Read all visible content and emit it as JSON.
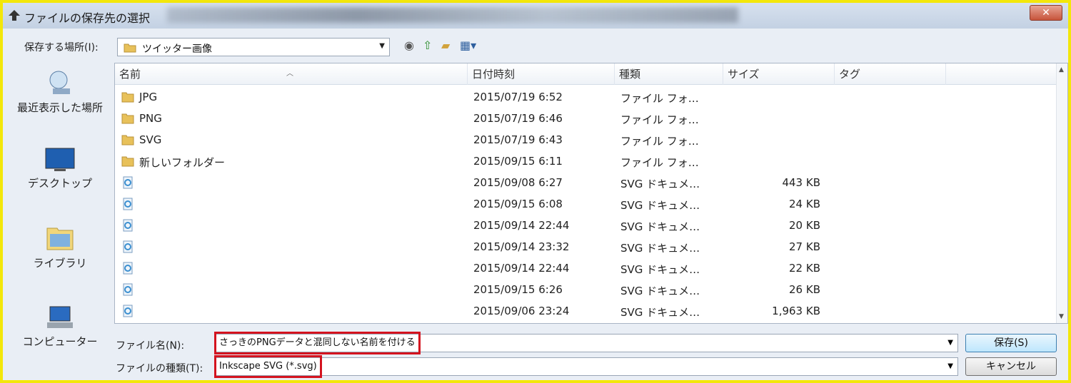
{
  "window": {
    "title": "ファイルの保存先の選択",
    "close_label": "✕"
  },
  "location": {
    "label": "保存する場所(I):",
    "value": "ツイッター画像"
  },
  "toolbar": {
    "back_icon": "back-icon",
    "up_icon": "up-folder-icon",
    "new_folder_icon": "new-folder-icon",
    "view_icon": "view-menu-icon"
  },
  "sidebar": {
    "items": [
      {
        "label": "最近表示した場所",
        "icon": "recent-places-icon"
      },
      {
        "label": "デスクトップ",
        "icon": "desktop-icon"
      },
      {
        "label": "ライブラリ",
        "icon": "library-icon"
      },
      {
        "label": "コンピューター",
        "icon": "computer-icon"
      }
    ]
  },
  "columns": [
    "名前",
    "日付時刻",
    "種類",
    "サイズ",
    "タグ"
  ],
  "files": [
    {
      "name": "JPG",
      "date": "2015/07/19 6:52",
      "type": "ファイル フォ…",
      "size": "",
      "kind": "folder"
    },
    {
      "name": "PNG",
      "date": "2015/07/19 6:46",
      "type": "ファイル フォ…",
      "size": "",
      "kind": "folder"
    },
    {
      "name": "SVG",
      "date": "2015/07/19 6:43",
      "type": "ファイル フォ…",
      "size": "",
      "kind": "folder"
    },
    {
      "name": "新しいフォルダー",
      "date": "2015/09/15 6:11",
      "type": "ファイル フォ…",
      "size": "",
      "kind": "folder"
    },
    {
      "name": "",
      "date": "2015/09/08 6:27",
      "type": "SVG ドキュメ…",
      "size": "443 KB",
      "kind": "svg"
    },
    {
      "name": "",
      "date": "2015/09/15 6:08",
      "type": "SVG ドキュメ…",
      "size": "24 KB",
      "kind": "svg"
    },
    {
      "name": "",
      "date": "2015/09/14 22:44",
      "type": "SVG ドキュメ…",
      "size": "20 KB",
      "kind": "svg"
    },
    {
      "name": "",
      "date": "2015/09/14 23:32",
      "type": "SVG ドキュメ…",
      "size": "27 KB",
      "kind": "svg"
    },
    {
      "name": "",
      "date": "2015/09/14 22:44",
      "type": "SVG ドキュメ…",
      "size": "22 KB",
      "kind": "svg"
    },
    {
      "name": "",
      "date": "2015/09/15 6:26",
      "type": "SVG ドキュメ…",
      "size": "26 KB",
      "kind": "svg"
    },
    {
      "name": "",
      "date": "2015/09/06 23:24",
      "type": "SVG ドキュメ…",
      "size": "1,963 KB",
      "kind": "svg"
    }
  ],
  "filename": {
    "label": "ファイル名(N):",
    "value": "さっきのPNGデータと混同しない名前を付ける"
  },
  "filetype": {
    "label": "ファイルの種類(T):",
    "value": "Inkscape SVG (*.svg)"
  },
  "buttons": {
    "save": "保存(S)",
    "cancel": "キャンセル"
  },
  "colors": {
    "highlight": "#d4131f",
    "frame": "#f3e70a"
  }
}
